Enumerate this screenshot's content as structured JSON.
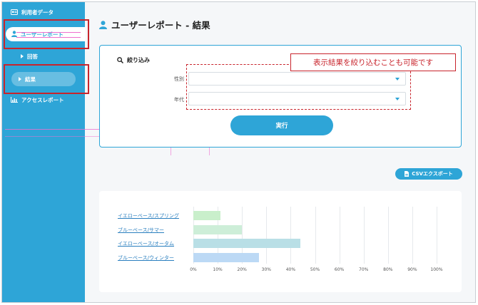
{
  "sidebar": {
    "items": [
      {
        "label": "利用者データ",
        "icon": "id-card-icon"
      },
      {
        "label": "ユーザーレポート",
        "icon": "user-icon"
      },
      {
        "label": "回答",
        "icon": "caret-right-icon"
      },
      {
        "label": "結果",
        "icon": "caret-right-icon"
      },
      {
        "label": "アクセスレポート",
        "icon": "bar-chart-icon"
      }
    ]
  },
  "page": {
    "title": "ユーザーレポート - 結果"
  },
  "filter": {
    "heading": "絞り込み",
    "gender_label": "性別",
    "age_label": "年代",
    "run_label": "実行"
  },
  "callout": {
    "text": "表示結果を絞り込むことも可能です"
  },
  "csv": {
    "label": "CSVエクスポート"
  },
  "colors": {
    "accent": "#2ea5d7",
    "highlight": "#c8242c",
    "bar_spring": "#c9efcb",
    "bar_summer": "#cdeed8",
    "bar_autumn": "#b9dfe6",
    "bar_winter": "#bcd9f5"
  },
  "chart_data": {
    "type": "bar",
    "orientation": "horizontal",
    "categories": [
      "イエローベース/スプリング",
      "ブルーベース/サマー",
      "イエローベース/オータム",
      "ブルーベース/ウィンター"
    ],
    "values": [
      11,
      20,
      44,
      27
    ],
    "x_ticks": [
      "0%",
      "10%",
      "20%",
      "30%",
      "40%",
      "50%",
      "60%",
      "70%",
      "80%",
      "90%",
      "100%"
    ],
    "xlim": [
      0,
      100
    ],
    "unit": "%",
    "grid": true
  }
}
